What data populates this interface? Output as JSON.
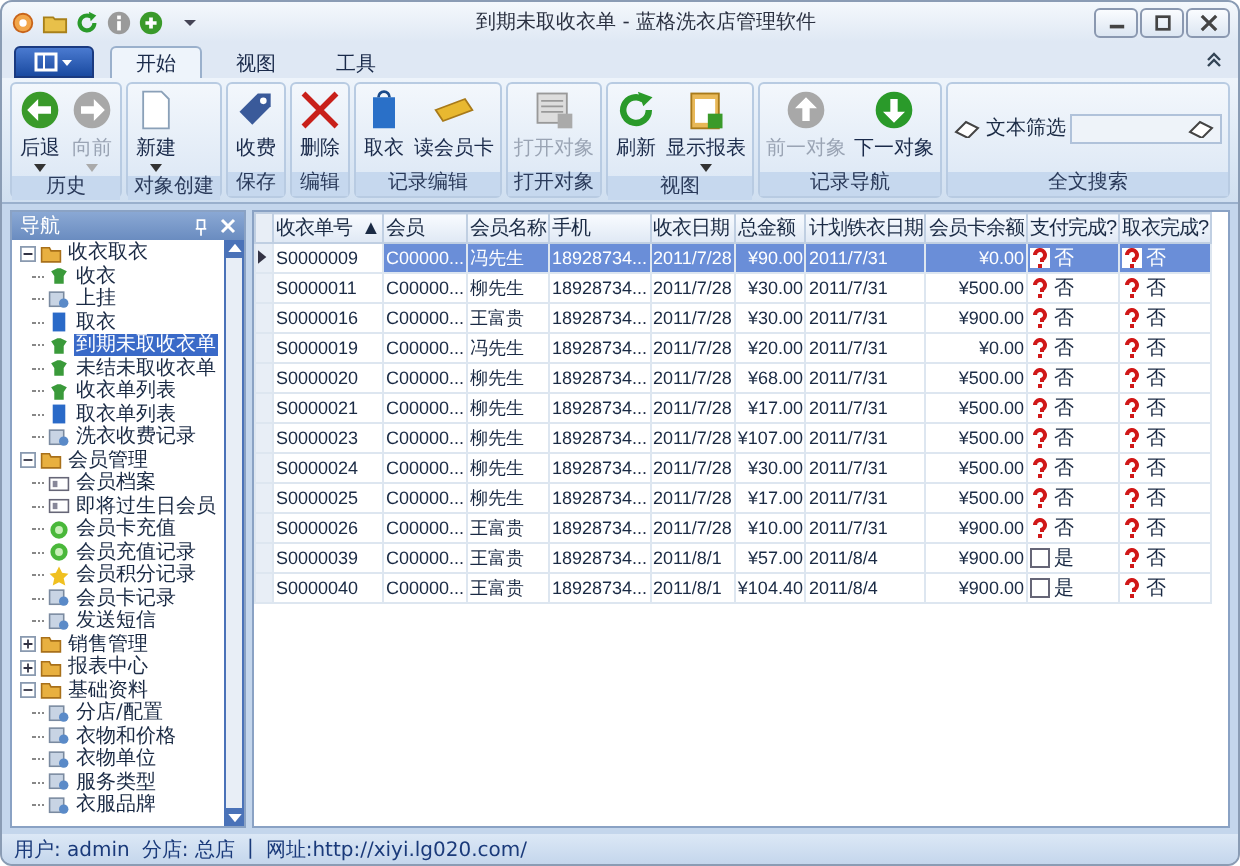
{
  "window": {
    "title": "到期未取收衣单 - 蓝格洗衣店管理软件"
  },
  "tabs": [
    {
      "label": "开始",
      "selected": true
    },
    {
      "label": "视图",
      "selected": false
    },
    {
      "label": "工具",
      "selected": false
    }
  ],
  "ribbon_groups": [
    {
      "label": "历史",
      "buttons": [
        {
          "label": "后退",
          "kind": "back",
          "disabled": false,
          "dropdown": true
        },
        {
          "label": "向前",
          "kind": "forward",
          "disabled": true,
          "dropdown": true
        }
      ]
    },
    {
      "label": "对象创建",
      "buttons": [
        {
          "label": "新建",
          "kind": "page",
          "disabled": false,
          "dropdown": true
        }
      ]
    },
    {
      "label": "保存",
      "buttons": [
        {
          "label": "收费",
          "kind": "tag",
          "disabled": false,
          "dropdown": false
        }
      ]
    },
    {
      "label": "编辑",
      "buttons": [
        {
          "label": "删除",
          "kind": "cross",
          "disabled": false,
          "dropdown": false
        }
      ]
    },
    {
      "label": "记录编辑",
      "buttons": [
        {
          "label": "取衣",
          "kind": "bag",
          "disabled": false,
          "dropdown": false
        },
        {
          "label": "读会员卡",
          "kind": "card",
          "disabled": false,
          "dropdown": false
        }
      ]
    },
    {
      "label": "打开对象",
      "buttons": [
        {
          "label": "打开对象",
          "kind": "form",
          "disabled": true,
          "dropdown": false
        }
      ]
    },
    {
      "label": "视图",
      "buttons": [
        {
          "label": "刷新",
          "kind": "refresh",
          "disabled": false,
          "dropdown": false
        },
        {
          "label": "显示报表",
          "kind": "clipboard",
          "disabled": false,
          "dropdown": true
        }
      ]
    },
    {
      "label": "记录导航",
      "buttons": [
        {
          "label": "前一对象",
          "kind": "up",
          "disabled": true,
          "dropdown": false
        },
        {
          "label": "下一对象",
          "kind": "down",
          "disabled": false,
          "dropdown": false
        }
      ]
    }
  ],
  "search_group": {
    "label": "全文搜索",
    "filter_label": "文本筛选"
  },
  "navigation": {
    "title": "导航",
    "items": [
      {
        "label": "收衣取衣",
        "expanded": true,
        "children": [
          {
            "label": "收衣",
            "kind": "shirt",
            "selected": false
          },
          {
            "label": "上挂",
            "kind": "gear",
            "selected": false
          },
          {
            "label": "取衣",
            "kind": "book",
            "selected": false
          },
          {
            "label": "到期未取收衣单",
            "kind": "shirt",
            "selected": true
          },
          {
            "label": "未结未取收衣单",
            "kind": "shirt",
            "selected": false
          },
          {
            "label": "收衣单列表",
            "kind": "shirt",
            "selected": false
          },
          {
            "label": "取衣单列表",
            "kind": "book",
            "selected": false
          },
          {
            "label": "洗衣收费记录",
            "kind": "gear",
            "selected": false
          }
        ]
      },
      {
        "label": "会员管理",
        "expanded": true,
        "children": [
          {
            "label": "会员档案",
            "kind": "card",
            "selected": false
          },
          {
            "label": "即将过生日会员",
            "kind": "card",
            "selected": false
          },
          {
            "label": "会员卡充值",
            "kind": "coin",
            "selected": false
          },
          {
            "label": "会员充值记录",
            "kind": "coin",
            "selected": false
          },
          {
            "label": "会员积分记录",
            "kind": "star",
            "selected": false
          },
          {
            "label": "会员卡记录",
            "kind": "gear",
            "selected": false
          },
          {
            "label": "发送短信",
            "kind": "gear",
            "selected": false
          }
        ]
      },
      {
        "label": "销售管理",
        "expanded": false
      },
      {
        "label": "报表中心",
        "expanded": false
      },
      {
        "label": "基础资料",
        "expanded": true,
        "children": [
          {
            "label": "分店/配置",
            "kind": "gear",
            "selected": false
          },
          {
            "label": "衣物和价格",
            "kind": "gear",
            "selected": false
          },
          {
            "label": "衣物单位",
            "kind": "gear",
            "selected": false
          },
          {
            "label": "服务类型",
            "kind": "gear",
            "selected": false
          },
          {
            "label": "衣服品牌",
            "kind": "gear",
            "selected": false
          }
        ]
      }
    ]
  },
  "table": {
    "columns": [
      "收衣单号",
      "会员",
      "会员名称",
      "手机",
      "收衣日期",
      "总金额",
      "计划铁衣日期",
      "会员卡余额",
      "支付完成?",
      "取衣完成?"
    ],
    "sort_indicator": "▲",
    "rows": [
      {
        "selected": true,
        "cells": [
          "S0000009",
          "C00000...",
          "冯先生",
          "18928734...",
          "2011/7/28",
          "¥90.00",
          "2011/7/31",
          "¥0.00"
        ],
        "paid": false,
        "paid_label": "否",
        "picked": false,
        "picked_label": "否"
      },
      {
        "selected": false,
        "cells": [
          "S0000011",
          "C00000...",
          "柳先生",
          "18928734...",
          "2011/7/28",
          "¥30.00",
          "2011/7/31",
          "¥500.00"
        ],
        "paid": false,
        "paid_label": "否",
        "picked": false,
        "picked_label": "否"
      },
      {
        "selected": false,
        "cells": [
          "S0000016",
          "C00000...",
          "王富贵",
          "18928734...",
          "2011/7/28",
          "¥30.00",
          "2011/7/31",
          "¥900.00"
        ],
        "paid": false,
        "paid_label": "否",
        "picked": false,
        "picked_label": "否"
      },
      {
        "selected": false,
        "cells": [
          "S0000019",
          "C00000...",
          "冯先生",
          "18928734...",
          "2011/7/28",
          "¥20.00",
          "2011/7/31",
          "¥0.00"
        ],
        "paid": false,
        "paid_label": "否",
        "picked": false,
        "picked_label": "否"
      },
      {
        "selected": false,
        "cells": [
          "S0000020",
          "C00000...",
          "柳先生",
          "18928734...",
          "2011/7/28",
          "¥68.00",
          "2011/7/31",
          "¥500.00"
        ],
        "paid": false,
        "paid_label": "否",
        "picked": false,
        "picked_label": "否"
      },
      {
        "selected": false,
        "cells": [
          "S0000021",
          "C00000...",
          "柳先生",
          "18928734...",
          "2011/7/28",
          "¥17.00",
          "2011/7/31",
          "¥500.00"
        ],
        "paid": false,
        "paid_label": "否",
        "picked": false,
        "picked_label": "否"
      },
      {
        "selected": false,
        "cells": [
          "S0000023",
          "C00000...",
          "柳先生",
          "18928734...",
          "2011/7/28",
          "¥107.00",
          "2011/7/31",
          "¥500.00"
        ],
        "paid": false,
        "paid_label": "否",
        "picked": false,
        "picked_label": "否"
      },
      {
        "selected": false,
        "cells": [
          "S0000024",
          "C00000...",
          "柳先生",
          "18928734...",
          "2011/7/28",
          "¥30.00",
          "2011/7/31",
          "¥500.00"
        ],
        "paid": false,
        "paid_label": "否",
        "picked": false,
        "picked_label": "否"
      },
      {
        "selected": false,
        "cells": [
          "S0000025",
          "C00000...",
          "柳先生",
          "18928734...",
          "2011/7/28",
          "¥17.00",
          "2011/7/31",
          "¥500.00"
        ],
        "paid": false,
        "paid_label": "否",
        "picked": false,
        "picked_label": "否"
      },
      {
        "selected": false,
        "cells": [
          "S0000026",
          "C00000...",
          "王富贵",
          "18928734...",
          "2011/7/28",
          "¥10.00",
          "2011/7/31",
          "¥900.00"
        ],
        "paid": false,
        "paid_label": "否",
        "picked": false,
        "picked_label": "否"
      },
      {
        "selected": false,
        "cells": [
          "S0000039",
          "C00000...",
          "王富贵",
          "18928734...",
          "2011/8/1",
          "¥57.00",
          "2011/8/4",
          "¥900.00"
        ],
        "paid": true,
        "paid_label": "是",
        "picked": false,
        "picked_label": "否"
      },
      {
        "selected": false,
        "cells": [
          "S0000040",
          "C00000...",
          "王富贵",
          "18928734...",
          "2011/8/1",
          "¥104.40",
          "2011/8/4",
          "¥900.00"
        ],
        "paid": true,
        "paid_label": "是",
        "picked": false,
        "picked_label": "否"
      }
    ]
  },
  "status_bar": {
    "user": "用户: admin",
    "branch": "分店: 总店",
    "separator": "|",
    "url": "网址:http://xiyi.lg020.com/"
  }
}
